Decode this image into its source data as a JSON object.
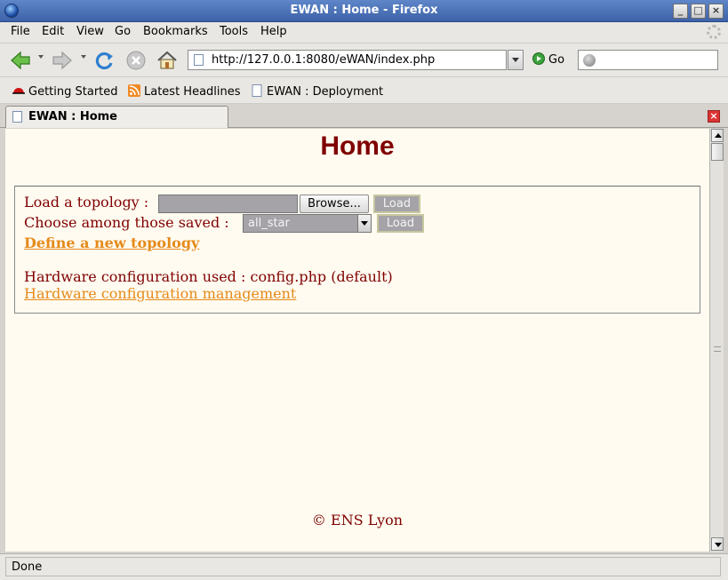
{
  "window": {
    "title": "EWAN : Home - Firefox",
    "buttons": {
      "minimize": "_",
      "maximize": "□",
      "close": "×"
    }
  },
  "menu": {
    "items": [
      {
        "label": "File"
      },
      {
        "label": "Edit"
      },
      {
        "label": "View"
      },
      {
        "label": "Go"
      },
      {
        "label": "Bookmarks"
      },
      {
        "label": "Tools"
      },
      {
        "label": "Help"
      }
    ]
  },
  "navigation": {
    "url": "http://127.0.0.1:8080/eWAN/index.php",
    "go_label": "Go",
    "search_value": ""
  },
  "bookmarks": {
    "items": [
      {
        "label": "Getting Started"
      },
      {
        "label": "Latest Headlines"
      },
      {
        "label": "EWAN : Deployment"
      }
    ]
  },
  "tabs": {
    "items": [
      {
        "label": "EWAN : Home"
      }
    ]
  },
  "page": {
    "title": "Home",
    "load_topology_label": "Load a topology :",
    "browse_label": "Browse...",
    "load_label": "Load",
    "choose_saved_label": "Choose among those saved :",
    "saved_selected": "all_star",
    "load2_label": "Load",
    "define_link": "Define a new topology",
    "hardware_config_text": "Hardware configuration used : config.php (default)",
    "hardware_management_link": "Hardware configuration management",
    "footer": "© ENS Lyon"
  },
  "status": {
    "text": "Done"
  },
  "colors": {
    "title_red": "#800000",
    "link_orange": "#e58a1a",
    "page_background": "#fffbf0",
    "titlebar_blue": "#4a70b8"
  }
}
